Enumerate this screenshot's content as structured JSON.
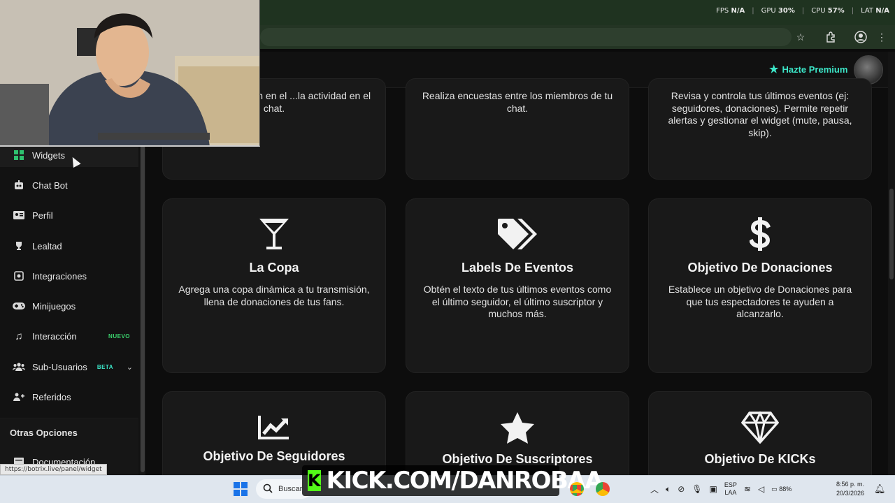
{
  "overlay_stats": [
    {
      "label": "FPS",
      "value": "N/A"
    },
    {
      "label": "GPU",
      "value": "30%"
    },
    {
      "label": "CPU",
      "value": "57%"
    },
    {
      "label": "LAT",
      "value": "N/A"
    }
  ],
  "header": {
    "premium_label": "Hazte Premium"
  },
  "sidebar": {
    "items": [
      {
        "label": "Widgets"
      },
      {
        "label": "Chat Bot"
      },
      {
        "label": "Perfil"
      },
      {
        "label": "Lealtad"
      },
      {
        "label": "Integraciones"
      },
      {
        "label": "Minijuegos"
      },
      {
        "label": "Interacción",
        "badge": "NUEVO"
      },
      {
        "label": "Sub-Usuarios",
        "badge": "BETA"
      },
      {
        "label": "Referidos"
      }
    ],
    "section_title": "Otras Opciones",
    "docs_label": "Documentación"
  },
  "cards_top": [
    {
      "desc": "...tes que se envían en el ...la actividad en el chat."
    },
    {
      "desc": "Realiza encuestas entre los miembros de tu chat."
    },
    {
      "desc": "Revisa y controla tus últimos eventos (ej: seguidores, donaciones). Permite repetir alertas y gestionar el widget (mute, pausa, skip)."
    }
  ],
  "cards_middle": [
    {
      "icon": "cocktail-icon",
      "title": "La Copa",
      "desc": "Agrega una copa dinámica a tu transmisión, llena de donaciones de tus fans."
    },
    {
      "icon": "tags-icon",
      "title": "Labels De Eventos",
      "desc": "Obtén el texto de tus últimos eventos como el último seguidor, el último suscriptor y muchos más."
    },
    {
      "icon": "dollar-icon",
      "title": "Objetivo De Donaciones",
      "desc": "Establece un objetivo de Donaciones para que tus espectadores te ayuden a alcanzarlo."
    }
  ],
  "cards_bottom": [
    {
      "icon": "chart-line-icon",
      "title": "Objetivo De Seguidores"
    },
    {
      "icon": "star-icon",
      "title": "Objetivo De Suscriptores"
    },
    {
      "icon": "gem-icon",
      "title": "Objetivo De KICKs"
    }
  ],
  "status_url": "https://botrix.live/panel/widget",
  "taskbar": {
    "search_placeholder": "Buscar",
    "kick_text": "KICK.COM/DANROBAA",
    "lang_top": "ESP",
    "lang_bottom": "LAA",
    "battery": "88%",
    "time": "8:56 p. m.",
    "date": "20/3/2026"
  }
}
